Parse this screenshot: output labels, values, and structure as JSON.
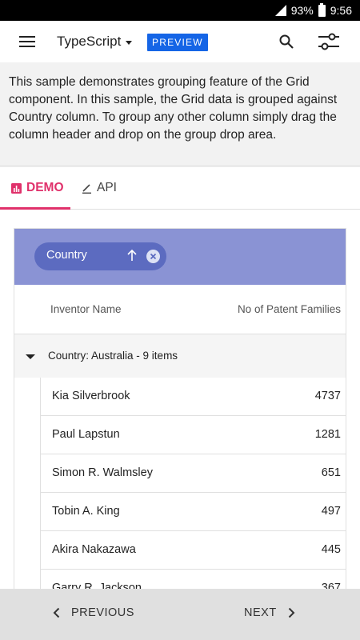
{
  "status_bar": {
    "battery": "93%",
    "time": "9:56"
  },
  "app_bar": {
    "language": "TypeScript",
    "badge": "PREVIEW"
  },
  "description": "This sample demonstrates grouping feature of the Grid component. In this sample, the Grid data is grouped against Country column. To group any other column simply drag the column header and drop on the group drop area.",
  "tabs": [
    {
      "label": "DEMO",
      "active": true
    },
    {
      "label": "API",
      "active": false
    }
  ],
  "grid": {
    "group_chip": "Country",
    "columns": [
      "Inventor Name",
      "No of Patent Families"
    ],
    "group_header": "Country: Australia - 9 items",
    "rows": [
      {
        "name": "Kia Silverbrook",
        "count": "4737"
      },
      {
        "name": "Paul Lapstun",
        "count": "1281"
      },
      {
        "name": "Simon R. Walmsley",
        "count": "651"
      },
      {
        "name": "Tobin A. King",
        "count": "497"
      },
      {
        "name": "Akira Nakazawa",
        "count": "445"
      },
      {
        "name": "Garry R. Jackson",
        "count": "367"
      }
    ]
  },
  "bottom_nav": {
    "previous": "PREVIOUS",
    "next": "NEXT"
  },
  "colors": {
    "accent": "#e0316b",
    "badge": "#1565e6",
    "group_area": "#8a93d4",
    "chip": "#5c6bc0"
  }
}
